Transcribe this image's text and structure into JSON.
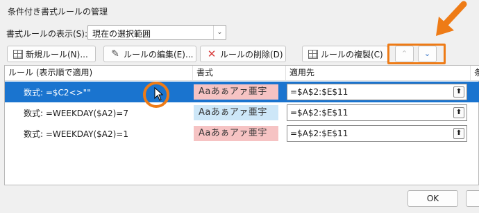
{
  "window": {
    "title": "条件付き書式ルールの管理"
  },
  "show_rules": {
    "label": "書式ルールの表示(S):",
    "selected": "現在の選択範囲"
  },
  "toolbar": {
    "new_rule": "新規ルール(N)...",
    "edit_rule": "ルールの編集(E)...",
    "delete_rule": "ルールの削除(D)",
    "duplicate_rule": "ルールの複製(C)",
    "move_up_icon": "chevron-up-icon",
    "move_down_icon": "chevron-down-icon"
  },
  "table": {
    "headers": [
      "ルール (表示順で適用)",
      "書式",
      "適用先",
      "条"
    ],
    "rows": [
      {
        "rule": "数式: =$C2<>\"\"",
        "format_sample": "Aaあぁアァ亜宇",
        "sample_color": "#f6c3c3",
        "applies_to": "=$A$2:$E$11",
        "selected": true
      },
      {
        "rule": "数式: =WEEKDAY($A2)=7",
        "format_sample": "Aaあぁアァ亜宇",
        "sample_color": "#cde7f8",
        "applies_to": "=$A$2:$E$11",
        "selected": false
      },
      {
        "rule": "数式: =WEEKDAY($A2)=1",
        "format_sample": "Aaあぁアァ亜宇",
        "sample_color": "#f6c3c3",
        "applies_to": "=$A$2:$E$11",
        "selected": false
      }
    ]
  },
  "footer": {
    "ok": "OK"
  },
  "colors": {
    "selection": "#1a74cf",
    "highlight": "#ee7b16"
  }
}
